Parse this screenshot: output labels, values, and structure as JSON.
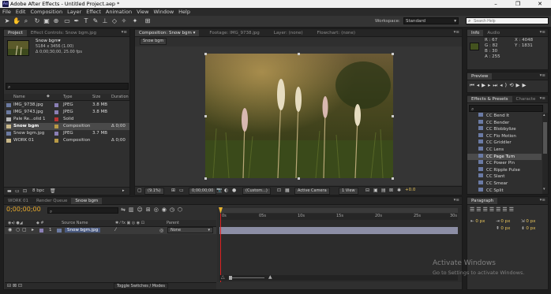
{
  "window": {
    "title": "Adobe After Effects - Untitled Project.aep *",
    "min": "–",
    "max": "❐",
    "close": "✕",
    "app_icon": "Ae"
  },
  "menu": [
    "File",
    "Edit",
    "Composition",
    "Layer",
    "Effect",
    "Animation",
    "View",
    "Window",
    "Help"
  ],
  "toolbar": {
    "workspace_label": "Workspace:",
    "workspace_value": "Standard",
    "search_placeholder": "Search Help"
  },
  "project": {
    "tabs": [
      "Project",
      "Effect Controls: Snow bgm.jpg"
    ],
    "item_name": "Snow bgm▾",
    "item_size": "5184 x 3456 (1.00)",
    "item_duration": "Δ 0;00;30;00, 25.00 fps",
    "columns": {
      "name": "Name",
      "type": "Type",
      "size": "Size",
      "duration": "Duration"
    },
    "items": [
      {
        "name": "IMG_9738.jpg",
        "color": "#8a7fb5",
        "type": "JPEG",
        "size": "3.8 MB",
        "duration": ""
      },
      {
        "name": "IMG_9743.jpg",
        "color": "#8a7fb5",
        "type": "JPEG",
        "size": "3.8 MB",
        "duration": ""
      },
      {
        "name": "Pale Re...olid 1",
        "color": "#b33",
        "type": "Solid",
        "size": "",
        "duration": ""
      },
      {
        "name": "Snow bgm",
        "color": "#b89a46",
        "type": "Composition",
        "size": "",
        "duration": "Δ 0;00"
      },
      {
        "name": "Snow bgm.jpg",
        "color": "#8a7fb5",
        "type": "JPEG",
        "size": "3.7 MB",
        "duration": ""
      },
      {
        "name": "WORK 01",
        "color": "#b89a46",
        "type": "Composition",
        "size": "",
        "duration": "Δ 0;00"
      }
    ],
    "bpc": "8 bpc"
  },
  "comp": {
    "tabs": [
      "Composition: Snow bgm",
      "Footage: IMG_9738.jpg",
      "Layer: (none)",
      "Flowchart: (none)"
    ],
    "subtab": "Snow bgm",
    "zoom": "(9.1%)",
    "timecode": "0;00;00;00",
    "quality": "(Custom...)",
    "camera": "Active Camera",
    "view": "1 View",
    "exposure": "+0.0"
  },
  "info": {
    "tabs": [
      "Info",
      "Audio"
    ],
    "r": "R : 67",
    "g": "G : 82",
    "b": "B : 30",
    "a": "A : 255",
    "x": "X : 4048",
    "y": "Y : 1831",
    "swatch": "#43521e"
  },
  "preview": {
    "tab": "Preview"
  },
  "effects": {
    "tabs": [
      "Effects & Presets",
      "Characte"
    ],
    "items": [
      "CC Bend It",
      "CC Bender",
      "CC Blobbylize",
      "CC Flo Motion",
      "CC Griddler",
      "CC Lens",
      "CC Page Turn",
      "CC Power Pin",
      "CC Ripple Pulse",
      "CC Slant",
      "CC Smear",
      "CC Split"
    ],
    "selected": 6
  },
  "paragraph": {
    "tab": "Paragraph",
    "vals": [
      "0 px",
      "0 px",
      "0 px",
      "0 px",
      "0 px"
    ]
  },
  "timeline": {
    "tabs": [
      "WORK 01",
      "Render Queue",
      "Snow bgm"
    ],
    "timecode": "0;00;00;00",
    "cols": {
      "source": "Source Name",
      "parent": "Parent"
    },
    "layer": {
      "num": "1",
      "name": "Snow bgm.jpg",
      "parent": "None"
    },
    "ruler": [
      "0s",
      "05s",
      "10s",
      "15s",
      "20s",
      "25s",
      "30s"
    ],
    "toggle": "Toggle Switches / Modes"
  },
  "watermark": {
    "line1": "Activate Windows",
    "line2": "Go to Settings to activate Windows."
  }
}
